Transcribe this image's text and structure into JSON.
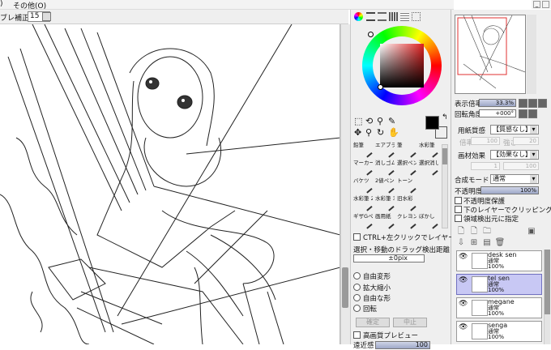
{
  "menu": {
    "partial_left": ")",
    "other": "その他(O)"
  },
  "toolbar": {
    "stab_label": "ブレ補正",
    "stab_value": "15"
  },
  "nav": {
    "zoom_label": "表示倍率",
    "zoom_value": "33.3%",
    "rot_label": "回転角度",
    "rot_value": "+000°"
  },
  "paper": {
    "texture_label": "用紙質感",
    "texture_value": "【質感なし】",
    "texture_scale": "倍率",
    "texture_scale_val": "100",
    "texture_strength": "強さ",
    "texture_strength_val": "20",
    "effect_label": "画材効果",
    "effect_value": "【効果なし】",
    "effect_val1": "1",
    "effect_val2": "100"
  },
  "blend": {
    "mode_label": "合成モード",
    "mode_value": "通常",
    "opacity_label": "不透明度",
    "opacity_value": "100%",
    "chk_preserve": "不透明度保護",
    "chk_clip": "下のレイヤーでクリッピング",
    "chk_ref": "領域検出元に指定"
  },
  "tools": [
    {
      "name": "pencil",
      "label": "鉛筆"
    },
    {
      "name": "airbrush",
      "label": "エアブラシ"
    },
    {
      "name": "brush",
      "label": "筆"
    },
    {
      "name": "watercolor",
      "label": "水彩筆"
    },
    {
      "name": "marker",
      "label": "マーカー"
    },
    {
      "name": "eraser",
      "label": "消しゴム"
    },
    {
      "name": "select-pen",
      "label": "選択ペン"
    },
    {
      "name": "select-eraser",
      "label": "選択消し"
    },
    {
      "name": "bucket",
      "label": "バケツ"
    },
    {
      "name": "two-value-pen",
      "label": "2値ペン"
    },
    {
      "name": "tone",
      "label": "トーン"
    },
    {
      "name": "empty",
      "label": ""
    },
    {
      "name": "watercolor2",
      "label": "水彩筆 2"
    },
    {
      "name": "watercolor3",
      "label": "水彩筆 3"
    },
    {
      "name": "old-watercolor",
      "label": "旧水彩"
    },
    {
      "name": "empty2",
      "label": ""
    },
    {
      "name": "g-pen",
      "label": "ギザGペン"
    },
    {
      "name": "paint-brush",
      "label": "画用紙"
    },
    {
      "name": "crayon",
      "label": "クレヨン"
    },
    {
      "name": "blur",
      "label": "ぼかし"
    }
  ],
  "select_opts": {
    "ctrl_label": "CTRL+左クリックでレイヤー選択",
    "drag_label": "選択・移動のドラッグ検出距離",
    "drag_value": "±0pix",
    "r1": "自由変形",
    "r2": "拡大縮小",
    "r3": "自由な形",
    "r4": "回転",
    "ok": "確定",
    "cancel": "中止",
    "hq_preview": "高画質プレビュー",
    "near_label": "遠近感",
    "near_value": "100"
  },
  "layers": [
    {
      "name": "desk sen",
      "mode": "通常",
      "opacity": "100%"
    },
    {
      "name": "tel sen",
      "mode": "通常",
      "opacity": "100%"
    },
    {
      "name": "megane",
      "mode": "通常",
      "opacity": "100%"
    },
    {
      "name": "senga",
      "mode": "通常",
      "opacity": "100%"
    }
  ],
  "colors": {
    "fg": "#000000",
    "bg": "#ffffff",
    "accent": "#c8c8f4"
  }
}
